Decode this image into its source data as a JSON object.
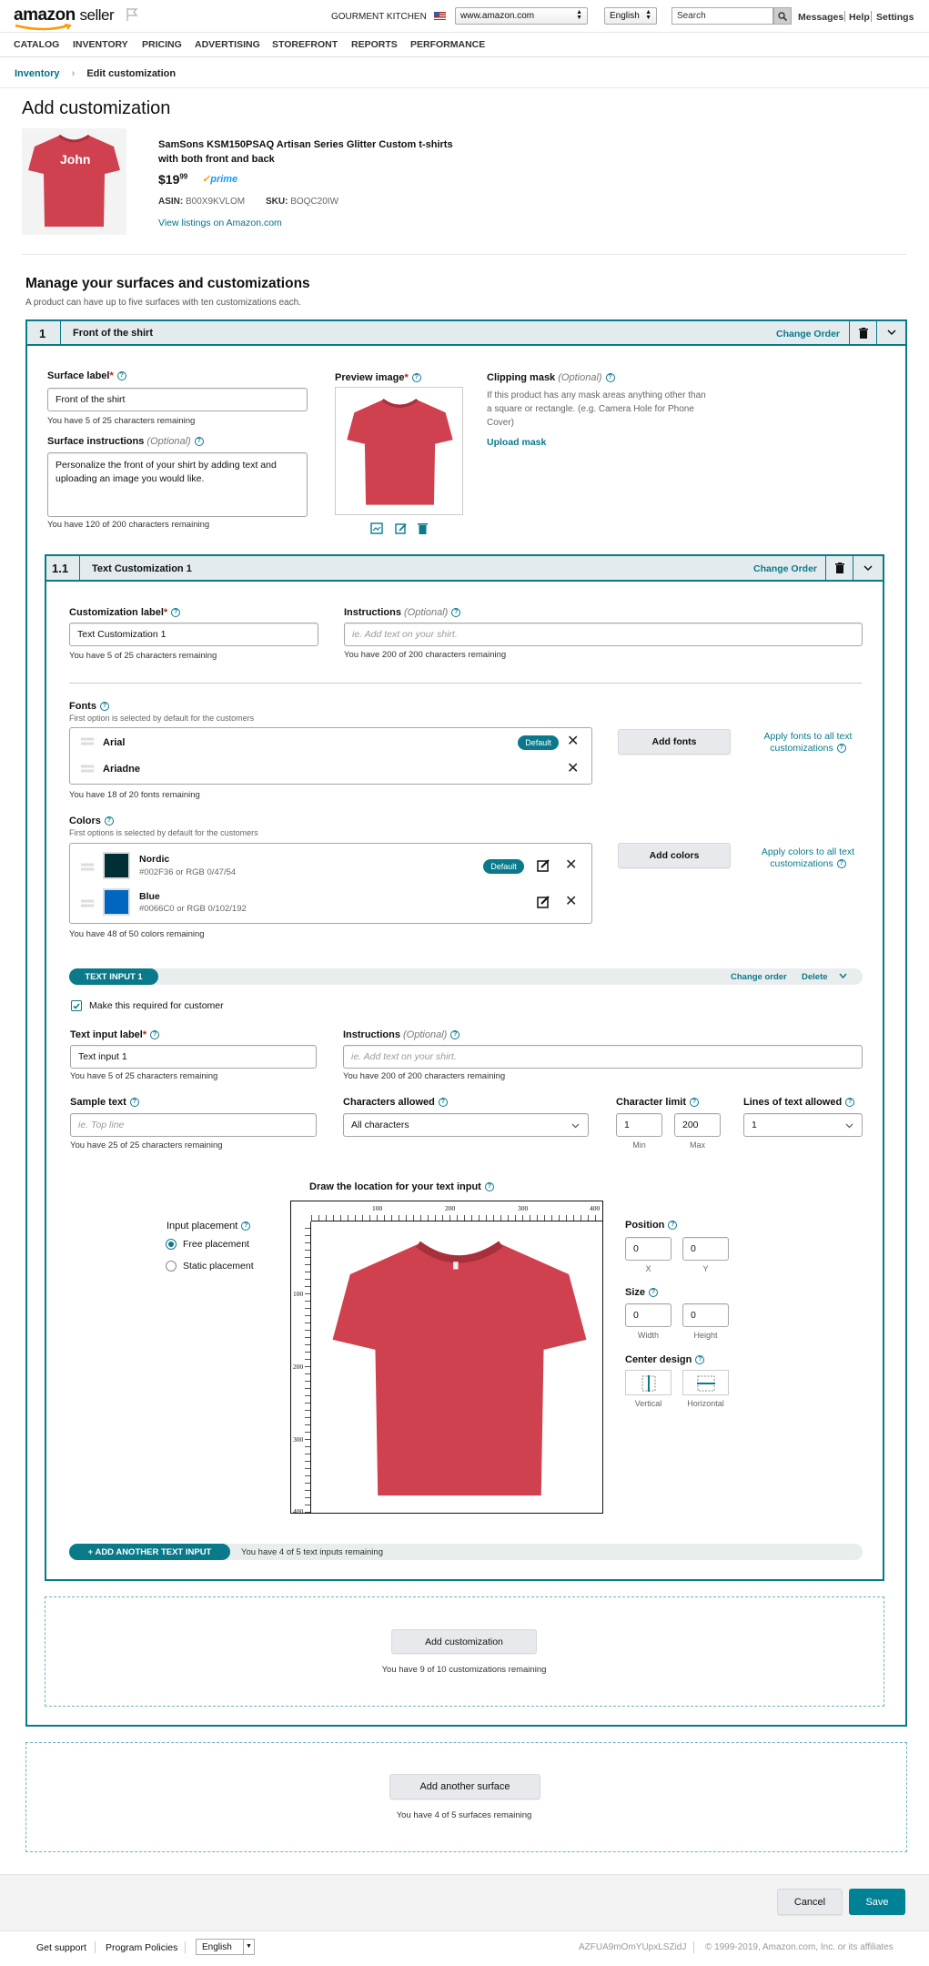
{
  "header": {
    "logo_main": "amazon",
    "logo_sub": "seller",
    "store": "GOURMENT KITCHEN",
    "marketplace": "www.amazon.com",
    "language": "English",
    "search_placeholder": "Search",
    "messages": "Messages",
    "help": "Help",
    "settings": "Settings"
  },
  "nav": [
    "CATALOG",
    "INVENTORY",
    "PRICING",
    "ADVERTISING",
    "STOREFRONT",
    "REPORTS",
    "PERFORMANCE"
  ],
  "breadcrumb": {
    "root": "Inventory",
    "current": "Edit customization"
  },
  "page_title": "Add customization",
  "product": {
    "shirt_text": "John",
    "name": "SamSons KSM150PSAQ Artisan Series Glitter Custom t-shirts with both front and back",
    "price_dollar": "$19",
    "price_cents": "99",
    "prime": "prime",
    "asin_label": "ASIN:",
    "asin": "B00X9KVLOM",
    "sku_label": "SKU:",
    "sku": "BOQC20IW",
    "view_link": "View listings on Amazon.com"
  },
  "manage": {
    "title": "Manage your surfaces and customizations",
    "subtitle": "A product can have up to five surfaces with ten customizations each."
  },
  "surface": {
    "number": "1",
    "title": "Front of the shirt",
    "change_order": "Change Order",
    "label_title": "Surface label",
    "label_value": "Front of the shirt",
    "label_note": "You have 5 of 25 characters remaining",
    "instr_title": "Surface instructions",
    "optional": "(Optional)",
    "instr_value": "Personalize the front of your shirt by adding text and uploading an image you would like.",
    "instr_note": "You have 120 of 200 characters remaining",
    "preview_title": "Preview image",
    "clip_title": "Clipping mask",
    "clip_desc": "If this product has any mask areas anything other than a square or rectangle. (e.g. Camera Hole for Phone Cover)",
    "upload_mask": "Upload mask"
  },
  "customization": {
    "number": "1.1",
    "title": "Text Customization 1",
    "change_order": "Change Order",
    "label_title": "Customization label",
    "label_value": "Text Customization 1",
    "label_note": "You have 5 of 25 characters remaining",
    "instr_title": "Instructions",
    "instr_placeholder": "ie. Add text on your shirt.",
    "instr_note": "You have 200 of 200 characters remaining",
    "fonts_title": "Fonts",
    "fonts_sub": "First option is selected by default for the customers",
    "fonts": [
      {
        "name": "Arial",
        "default": "Default"
      },
      {
        "name": "Ariadne",
        "default": ""
      }
    ],
    "fonts_note": "You have 18 of 20 fonts remaining",
    "add_fonts": "Add fonts",
    "apply_fonts": "Apply fonts to all text customizations",
    "colors_title": "Colors",
    "colors_sub": "First options is selected by default for the customers",
    "colors": [
      {
        "name": "Nordic",
        "code": "#002F36 or RGB 0/47/54",
        "swatch": "#002F36",
        "default": "Default"
      },
      {
        "name": "Blue",
        "code": "#0066C0 or RGB 0/102/192",
        "swatch": "#0066C0",
        "default": ""
      }
    ],
    "colors_note": "You have 48 of 50 colors remaining",
    "add_colors": "Add colors",
    "apply_colors": "Apply colors to all text customizations"
  },
  "text_input": {
    "tag": "TEXT INPUT 1",
    "change_order": "Change order",
    "delete": "Delete",
    "required_label": "Make this required for customer",
    "label_title": "Text input label",
    "label_value": "Text input 1",
    "label_note": "You have 5 of 25 characters remaining",
    "instr_title": "Instructions",
    "instr_placeholder": "ie. Add text on your shirt.",
    "instr_note": "You have 200 of 200 characters remaining",
    "sample_title": "Sample text",
    "sample_placeholder": "ie. Top line",
    "sample_note": "You have 25 of 25 characters remaining",
    "chars_title": "Characters allowed",
    "chars_value": "All characters",
    "limit_title": "Character limit",
    "limit_min": "1",
    "limit_max": "200",
    "min_label": "Min",
    "max_label": "Max",
    "lines_title": "Lines of text allowed",
    "lines_value": "1",
    "draw_title": "Draw the location for your text input",
    "placement_title": "Input placement",
    "free": "Free placement",
    "static": "Static placement",
    "ruler_x": [
      "100",
      "200",
      "300",
      "400"
    ],
    "ruler_y": [
      "100",
      "200",
      "300",
      "400"
    ],
    "position_title": "Position",
    "pos_x": "0",
    "pos_y": "0",
    "x_label": "X",
    "y_label": "Y",
    "size_title": "Size",
    "width": "0",
    "height": "0",
    "width_label": "Width",
    "height_label": "Height",
    "center_title": "Center design",
    "vertical": "Vertical",
    "horizontal": "Horizontal",
    "add_another": "+ ADD ANOTHER TEXT INPUT",
    "remaining": "You have 4 of 5 text inputs remaining"
  },
  "add_customization": {
    "button": "Add customization",
    "note": "You have 9 of 10 customizations remaining"
  },
  "add_surface": {
    "button": "Add another surface",
    "note": "You have 4 of 5 surfaces remaining"
  },
  "actions": {
    "cancel": "Cancel",
    "save": "Save"
  },
  "footer": {
    "support": "Get support",
    "policies": "Program Policies",
    "language": "English",
    "session": "AZFUA9mOmYUpxLSZidJ",
    "copyright": "© 1999-2019, Amazon.com, Inc. or its affiliates"
  },
  "colors": {
    "teal": "#0A7A8A",
    "shirt": "#D0414F",
    "save": "#008296"
  }
}
